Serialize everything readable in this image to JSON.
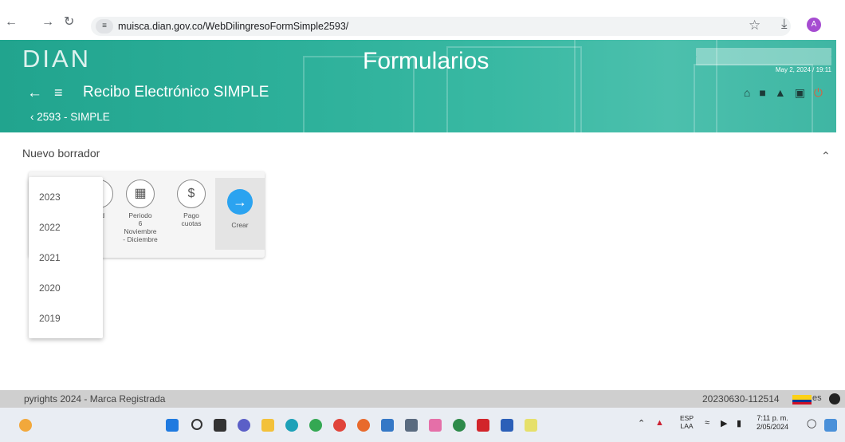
{
  "browser": {
    "url": "muisca.dian.gov.co/WebDilingresoFormSimple2593/",
    "profile_initial": "A"
  },
  "header": {
    "logo": "DIAN",
    "title": "Formularios",
    "form_title": "Recibo Electrónico SIMPLE",
    "breadcrumb": "2593 - SIMPLE",
    "user_date": "May 2, 2024 / 19:11"
  },
  "content": {
    "section_title": "Nuevo borrador",
    "steps": [
      {
        "label_l1": "dad",
        "label_l2": "al"
      },
      {
        "label_l1": "Periodo",
        "label_l2": "6",
        "label_l3": "Noviembre",
        "label_l4": "- Diciembre"
      },
      {
        "label_l1": "Pago",
        "label_l2": "cuotas"
      }
    ],
    "crear_label": "Crear",
    "year_options": [
      "2023",
      "2022",
      "2021",
      "2020",
      "2019"
    ]
  },
  "footer": {
    "copyright": "pyrights 2024 - Marca Registrada",
    "version": "20230630-112514",
    "lang": "es"
  },
  "taskbar": {
    "lang_line1": "ESP",
    "lang_line2": "LAA",
    "time": "7:11 p. m.",
    "date": "2/05/2024"
  },
  "colors": {
    "header_teal": "#2db09a",
    "accent_blue": "#2ba3f0"
  }
}
